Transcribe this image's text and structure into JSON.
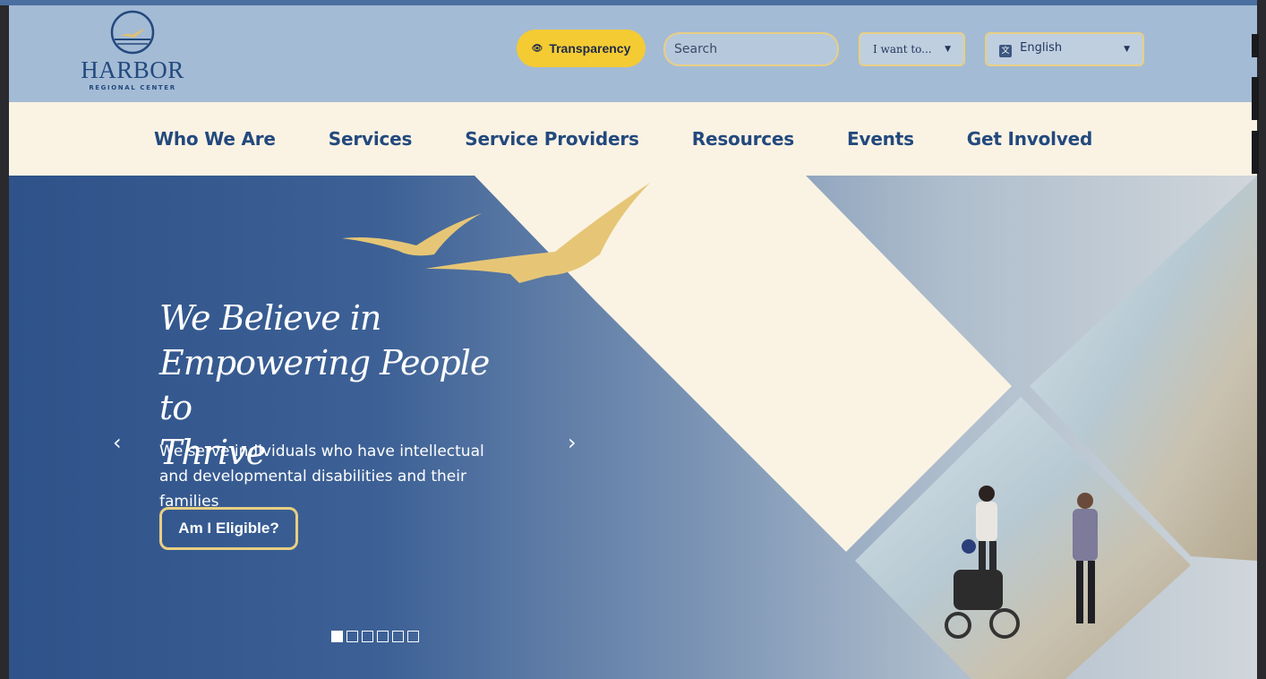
{
  "header": {
    "logo_text": "HARBOR",
    "logo_sub": "REGIONAL CENTER",
    "transparency_label": "Transparency",
    "search_placeholder": "Search",
    "iwant_label": "I want to...",
    "language_label": "English"
  },
  "nav": {
    "items": [
      {
        "label": "Who We Are"
      },
      {
        "label": "Services"
      },
      {
        "label": "Service Providers"
      },
      {
        "label": "Resources"
      },
      {
        "label": "Events"
      },
      {
        "label": "Get Involved"
      }
    ]
  },
  "hero": {
    "headline_line1": "We Believe in",
    "headline_line2": "Empowering People to",
    "headline_line3": "Thrive",
    "subtitle": "We serve individuals who have intellectual and developmental disabilities and their families",
    "cta_label": "Am I Eligible?",
    "prev_arrow": "‹",
    "next_arrow": "›",
    "slide_count": 6,
    "active_slide": 1
  },
  "colors": {
    "header_bg": "#a4bbd5",
    "nav_bg": "#faf3e4",
    "brand_navy": "#23497d",
    "accent_gold": "#f4cb33",
    "border_gold": "#e8cf83"
  }
}
